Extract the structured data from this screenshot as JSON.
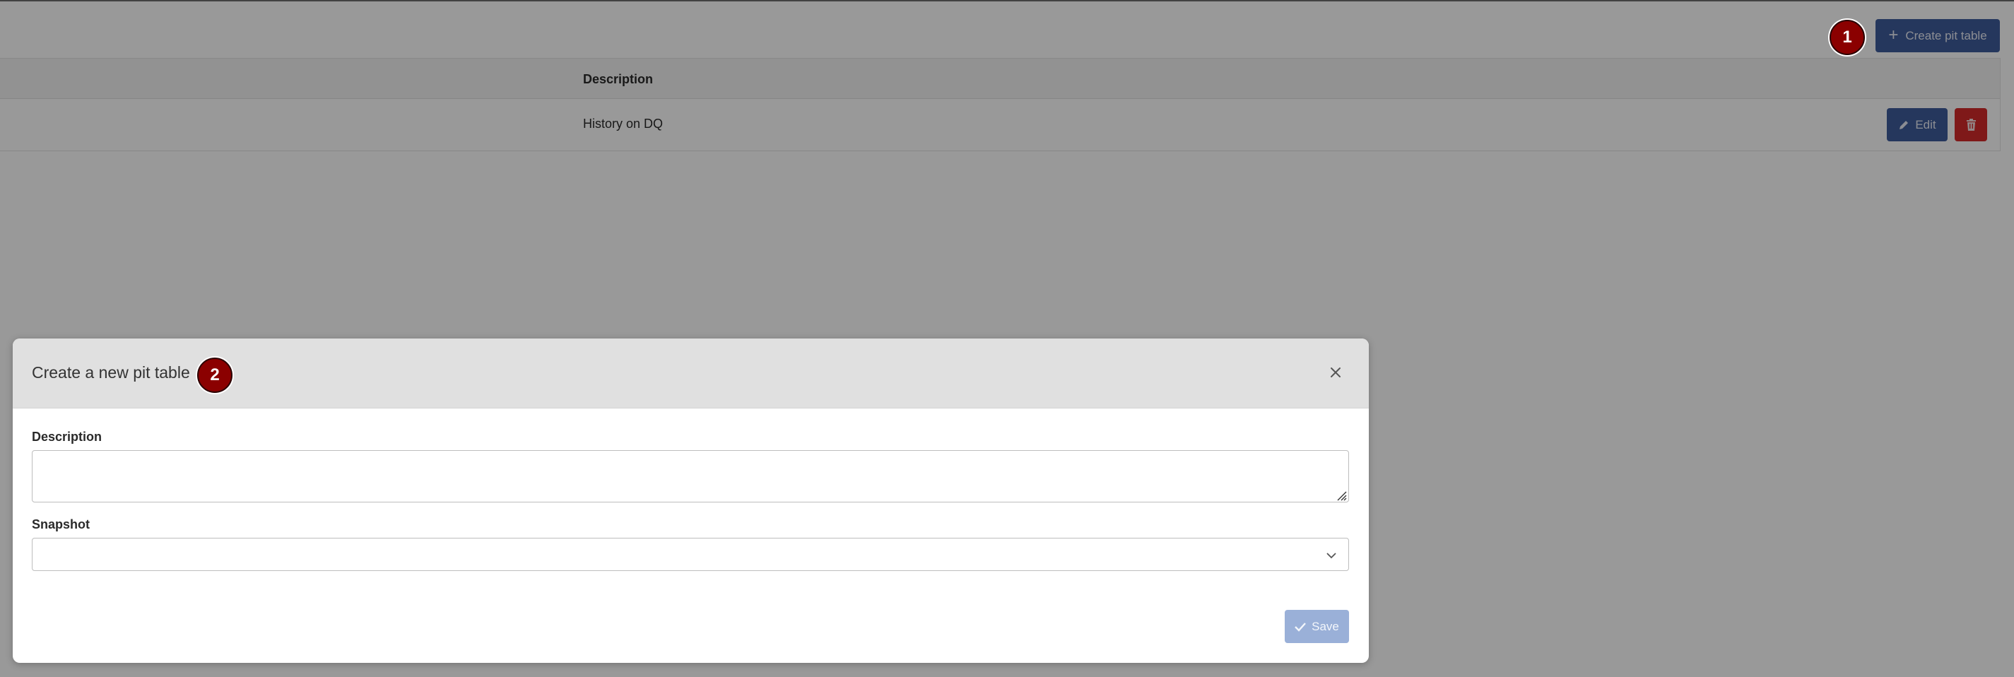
{
  "toolbar": {
    "create_label": "Create pit table",
    "create_icon": "plus-icon"
  },
  "table": {
    "columns": [
      "Description"
    ],
    "rows": [
      {
        "description": "History on DQ",
        "edit_label": "Edit"
      }
    ]
  },
  "modal": {
    "title": "Create a new pit table",
    "fields": {
      "description_label": "Description",
      "description_value": "",
      "snapshot_label": "Snapshot",
      "snapshot_value": ""
    },
    "save_label": "Save"
  },
  "badges": [
    "1",
    "2"
  ],
  "colors": {
    "primary": "#3f5c9c",
    "danger": "#d42a2a",
    "save_disabled": "#9ab0d8",
    "badge": "#8b0000",
    "modal_header": "#e0e0e0"
  }
}
